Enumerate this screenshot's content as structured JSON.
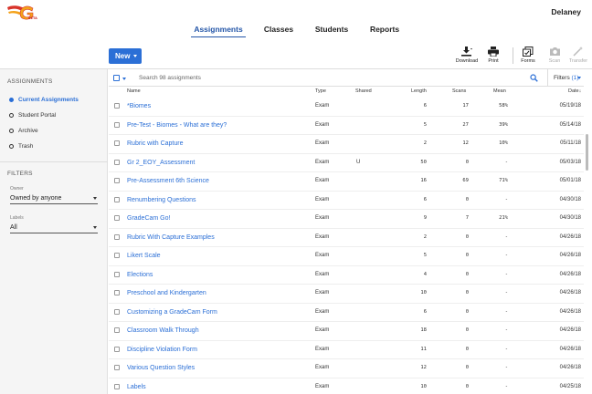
{
  "header": {
    "logo_text": "BETA",
    "user_name": "Delaney",
    "nav_tabs": [
      {
        "label": "Assignments",
        "active": true
      },
      {
        "label": "Classes",
        "active": false
      },
      {
        "label": "Students",
        "active": false
      },
      {
        "label": "Reports",
        "active": false
      }
    ]
  },
  "toolbar": {
    "new_label": "New",
    "download_label": "Download",
    "print_label": "Print",
    "forms_label": "Forms",
    "scan_label": "Scan",
    "transfer_label": "Transfer"
  },
  "sidebar": {
    "section_title": "ASSIGNMENTS",
    "items": [
      {
        "label": "Current Assignments",
        "active": true
      },
      {
        "label": "Student Portal",
        "active": false
      },
      {
        "label": "Archive",
        "active": false
      },
      {
        "label": "Trash",
        "active": false
      }
    ],
    "filters_title": "FILTERS",
    "owner_label": "Owner",
    "owner_value": "Owned by anyone",
    "labels_label": "Labels",
    "labels_value": "All"
  },
  "search": {
    "placeholder": "Search 98 assignments",
    "filters_label": "Filters",
    "filters_count": "(1)"
  },
  "table": {
    "columns": {
      "name": "Name",
      "type": "Type",
      "shared": "Shared",
      "length": "Length",
      "scans": "Scans",
      "mean": "Mean",
      "date": "Date"
    },
    "rows": [
      {
        "name": "*Biomes",
        "type": "Exam",
        "shared": "",
        "length": "6",
        "scans": "17",
        "mean": "58%",
        "date": "05/19/18"
      },
      {
        "name": "Pre-Test - Biomes - What are they?",
        "type": "Exam",
        "shared": "",
        "length": "5",
        "scans": "27",
        "mean": "39%",
        "date": "05/14/18"
      },
      {
        "name": "Rubric with Capture",
        "type": "Exam",
        "shared": "",
        "length": "2",
        "scans": "12",
        "mean": "10%",
        "date": "05/11/18"
      },
      {
        "name": "Gr 2_EOY_Assessment",
        "type": "Exam",
        "shared": "U",
        "length": "50",
        "scans": "0",
        "mean": "-",
        "date": "05/03/18"
      },
      {
        "name": "Pre-Assessment 6th Science",
        "type": "Exam",
        "shared": "",
        "length": "16",
        "scans": "69",
        "mean": "71%",
        "date": "05/01/18"
      },
      {
        "name": "Renumbering Questions",
        "type": "Exam",
        "shared": "",
        "length": "6",
        "scans": "0",
        "mean": "-",
        "date": "04/30/18"
      },
      {
        "name": "GradeCam Go!",
        "type": "Exam",
        "shared": "",
        "length": "9",
        "scans": "7",
        "mean": "21%",
        "date": "04/30/18"
      },
      {
        "name": "Rubric With Capture Examples",
        "type": "Exam",
        "shared": "",
        "length": "2",
        "scans": "0",
        "mean": "-",
        "date": "04/26/18"
      },
      {
        "name": "Likert Scale",
        "type": "Exam",
        "shared": "",
        "length": "5",
        "scans": "0",
        "mean": "-",
        "date": "04/26/18"
      },
      {
        "name": "Elections",
        "type": "Exam",
        "shared": "",
        "length": "4",
        "scans": "0",
        "mean": "-",
        "date": "04/26/18"
      },
      {
        "name": "Preschool and Kindergarten",
        "type": "Exam",
        "shared": "",
        "length": "10",
        "scans": "0",
        "mean": "-",
        "date": "04/26/18"
      },
      {
        "name": "Customizing a GradeCam Form",
        "type": "Exam",
        "shared": "",
        "length": "6",
        "scans": "0",
        "mean": "-",
        "date": "04/26/18"
      },
      {
        "name": "Classroom Walk Through",
        "type": "Exam",
        "shared": "",
        "length": "18",
        "scans": "0",
        "mean": "-",
        "date": "04/26/18"
      },
      {
        "name": "Discipline Violation Form",
        "type": "Exam",
        "shared": "",
        "length": "11",
        "scans": "0",
        "mean": "-",
        "date": "04/26/18"
      },
      {
        "name": "Various Question Styles",
        "type": "Exam",
        "shared": "",
        "length": "12",
        "scans": "0",
        "mean": "-",
        "date": "04/26/18"
      },
      {
        "name": "Labels",
        "type": "Exam",
        "shared": "",
        "length": "10",
        "scans": "0",
        "mean": "-",
        "date": "04/25/18"
      }
    ]
  },
  "colors": {
    "accent": "#2b6fd6",
    "nav_active": "#2456a8",
    "logo_orange": "#f4a21a",
    "logo_red": "#d8332a"
  }
}
